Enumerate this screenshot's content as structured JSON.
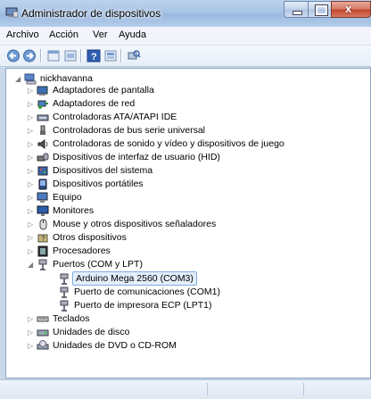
{
  "window": {
    "title": "Administrador de dispositivos"
  },
  "menu": {
    "items": [
      "Archivo",
      "Acción",
      "Ver",
      "Ayuda"
    ]
  },
  "toolbar": {
    "icons": [
      "back-arrow-icon",
      "forward-arrow-icon",
      "properties-icon",
      "display-icon",
      "help-icon",
      "show-hidden-icon",
      "scan-hardware-icon"
    ]
  },
  "tree": {
    "root": "nickhavanna",
    "items": [
      {
        "label": "Adaptadores de pantalla",
        "icon": "monitor-card-icon"
      },
      {
        "label": "Adaptadores de red",
        "icon": "network-adapter-icon"
      },
      {
        "label": "Controladoras ATA/ATAPI IDE",
        "icon": "ide-controller-icon"
      },
      {
        "label": "Controladoras de bus serie universal",
        "icon": "usb-plug-icon"
      },
      {
        "label": "Controladoras de sonido y vídeo y dispositivos de juego",
        "icon": "speaker-icon"
      },
      {
        "label": "Dispositivos de interfaz de usuario (HID)",
        "icon": "hid-icon"
      },
      {
        "label": "Dispositivos del sistema",
        "icon": "system-device-icon"
      },
      {
        "label": "Dispositivos portátiles",
        "icon": "portable-device-icon"
      },
      {
        "label": "Equipo",
        "icon": "computer-icon"
      },
      {
        "label": "Monitores",
        "icon": "monitor-icon"
      },
      {
        "label": "Mouse y otros dispositivos señaladores",
        "icon": "mouse-icon"
      },
      {
        "label": "Otros dispositivos",
        "icon": "unknown-device-icon"
      },
      {
        "label": "Procesadores",
        "icon": "processor-icon"
      },
      {
        "label": "Puertos (COM y LPT)",
        "icon": "port-icon",
        "children": [
          {
            "label": "Arduino Mega 2560 (COM3)",
            "selected": true
          },
          {
            "label": "Puerto de comunicaciones (COM1)"
          },
          {
            "label": "Puerto de impresora ECP (LPT1)"
          }
        ]
      },
      {
        "label": "Teclados",
        "icon": "keyboard-icon"
      },
      {
        "label": "Unidades de disco",
        "icon": "disk-drive-icon"
      },
      {
        "label": "Unidades de DVD o CD-ROM",
        "icon": "dvd-drive-icon"
      }
    ]
  },
  "colors": {
    "selection_bg": "#e2eefc",
    "selection_border": "#84acdd",
    "title_gradient": "#a8c4e6"
  }
}
